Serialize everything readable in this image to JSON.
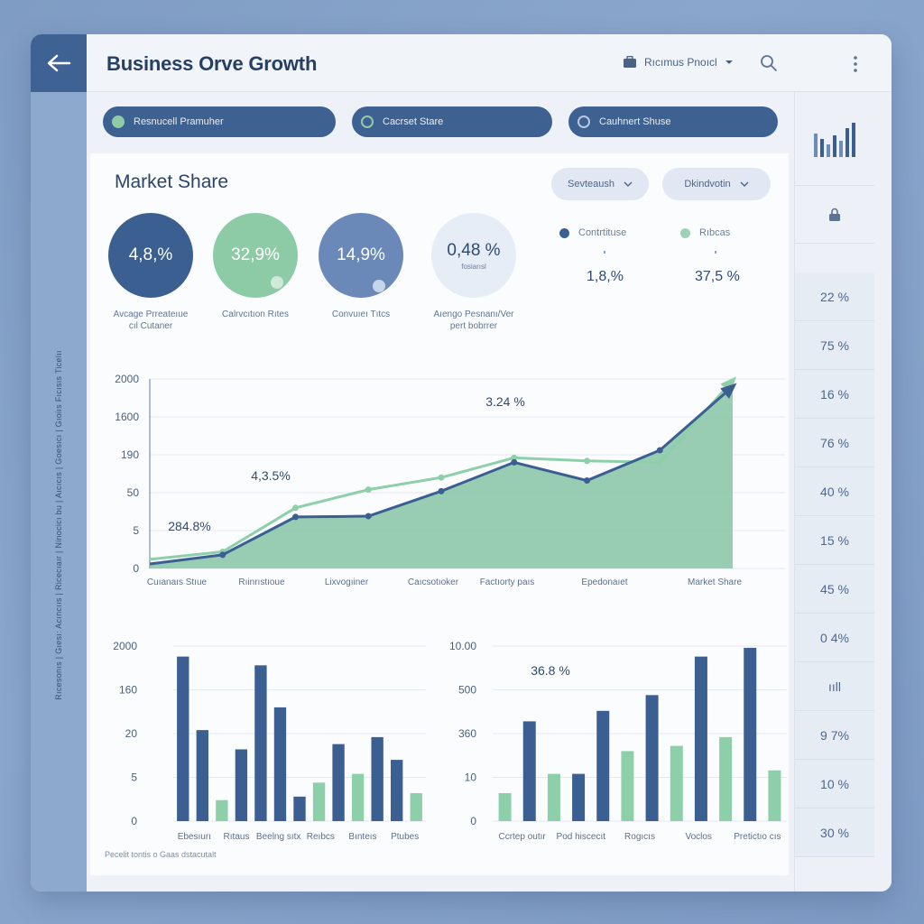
{
  "header": {
    "title": "Business Orve Growth",
    "product_label": "Rıcımus Pnoıcl"
  },
  "left_rail_text": "Rıcesonıs | Gıesı: Acıncııs | Ricecıaır | Ninocicı bu | Aıcıcıs | Goesıcı | Gıoiıs Fıcısıs Ticelıı",
  "filters": [
    {
      "label": "Resnucell Pramuher",
      "dot_color": "#8fcba8"
    },
    {
      "label": "Cacrset Stare",
      "dot_color": "#8fcba8"
    },
    {
      "label": "Cauhnert Shuse",
      "dot_color": "#3d6190"
    }
  ],
  "card": {
    "title": "Market Share",
    "dropdowns": [
      "Sevteaush",
      "Dkindvotin"
    ],
    "footnote": "Pecelit tontis o Gaas dstacutalt"
  },
  "kpis": [
    {
      "value": "4,8,%",
      "label_line1": "Avcage Prreateıue",
      "label_line2": "cıl Cutaner",
      "color": "#3c5f91"
    },
    {
      "value": "32,9%",
      "label_line1": "Calrvcıtıon Rıtes",
      "label_line2": "",
      "color": "#8dcba6"
    },
    {
      "value": "14,9%",
      "label_line1": "Convuıeı Tıtcs",
      "label_line2": "",
      "color": "#6a89b8"
    },
    {
      "value": "0,48 %",
      "sub": "fosiarısl",
      "label_line1": "Aıengo Pesnanı/Ver",
      "label_line2": "pert bobrrer",
      "color": "#e7edf7"
    }
  ],
  "legend": [
    {
      "label": "Contrtituse",
      "value": "1,8,%",
      "color": "#3c5f91"
    },
    {
      "label": "Rıbcas",
      "value": "37,5 %",
      "color": "#9fd2b5"
    }
  ],
  "chart_data": [
    {
      "type": "line",
      "y_tick_labels": [
        "0",
        "5",
        "50",
        "190",
        "1600",
        "2000"
      ],
      "x_tick_labels": [
        "Cuıanaıs Stıue",
        "Rıinrıstıoue",
        "Lixvogıiner",
        "Caıcsotıoker",
        "Factıorty paıs",
        "Epedonaıet",
        "Market Share"
      ],
      "annotations": [
        "284.8%",
        "4,3.5%",
        "3.24 %"
      ],
      "series": [
        {
          "values": [
            0.3,
            0.9,
            3.4,
            3.45,
            5.1,
            7.0,
            5.8,
            7.8,
            12.0
          ],
          "color": "#3c5f91"
        },
        {
          "values": [
            0.6,
            1.1,
            4.0,
            5.2,
            6.0,
            7.3,
            7.1,
            7.0,
            12.4
          ],
          "color": "#8ccfa8"
        }
      ],
      "area_color": "#86c4a6",
      "grid": true
    },
    {
      "type": "bar",
      "y_tick_labels": [
        "0",
        "5",
        "20",
        "160",
        "2000"
      ],
      "x_tick_labels": [
        "Ebesıurı",
        "Rıtaus",
        "Beelng sıtx",
        "Reıbcs",
        "Bınteıs",
        "Ptubes"
      ],
      "bar_values": [
        9.4,
        5.2,
        1.2,
        4.1,
        8.9,
        6.5,
        1.4,
        2.2,
        4.4,
        2.7,
        4.8,
        3.5,
        1.6
      ],
      "bar_colors": [
        "#3c5f91",
        "#3c5f91",
        "#8ccfa8",
        "#3c5f91",
        "#3c5f91",
        "#3c5f91",
        "#3c5f91",
        "#8ccfa8",
        "#3c5f91",
        "#8ccfa8",
        "#3c5f91",
        "#3c5f91",
        "#8ccfa8"
      ],
      "ylim": [
        0,
        10
      ],
      "grid": true
    },
    {
      "type": "bar",
      "y_tick_labels": [
        "0",
        "10",
        "360",
        "500",
        "10.00"
      ],
      "x_tick_labels": [
        "Ccrtep outır",
        "Pod hiscecıt",
        "Rogıcıs",
        "Voclos",
        "Pretictıo cıs"
      ],
      "annotations": [
        "36.8 %"
      ],
      "bar_values": [
        1.6,
        5.7,
        2.7,
        2.7,
        6.3,
        4.0,
        7.2,
        4.3,
        9.4,
        4.8,
        9.9,
        2.9
      ],
      "bar_colors": [
        "#8ccfa8",
        "#3c5f91",
        "#8ccfa8",
        "#3c5f91",
        "#3c5f91",
        "#8ccfa8",
        "#3c5f91",
        "#8ccfa8",
        "#3c5f91",
        "#8ccfa8",
        "#3c5f91",
        "#8ccfa8"
      ],
      "ylim": [
        0,
        10
      ],
      "grid": true
    }
  ],
  "right_panel": {
    "values": [
      "22 %",
      "75 %",
      "16 %",
      "76 %",
      "40 %",
      "15 %",
      "45 %",
      "0 4%",
      "ııll",
      "9 7%",
      "10 %",
      "30 %"
    ]
  },
  "colors": {
    "navy": "#3c5f91",
    "mint": "#8ccfa8",
    "accent_blue": "#3e6294"
  }
}
